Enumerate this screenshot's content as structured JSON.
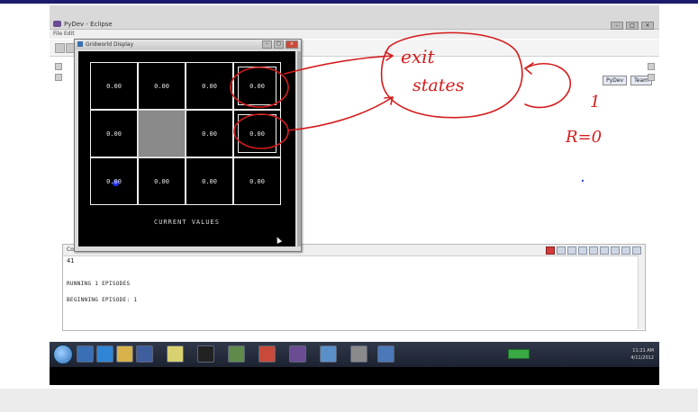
{
  "eclipse": {
    "title": "PyDev - Eclipse",
    "menubar": "File Edit",
    "perspective_pydev": "PyDev",
    "perspective_team": "Team"
  },
  "gridworld": {
    "window_title": "Gridworld Display",
    "caption": "CURRENT VALUES",
    "rows": [
      [
        "0.00",
        "0.00",
        "0.00",
        "0.00"
      ],
      [
        "0.00",
        "",
        "0.00",
        "0.00"
      ],
      [
        "0.00",
        "0.00",
        "0.00",
        "0.00"
      ]
    ],
    "wall_cell": [
      1,
      1
    ],
    "exit_cells": [
      [
        0,
        3
      ],
      [
        1,
        3
      ]
    ],
    "agent_cell": [
      2,
      0
    ]
  },
  "console": {
    "tab": "Console",
    "status": "41",
    "lines": [
      "RUNNING 1 EPISODES",
      "BEGINNING EPISODE: 1"
    ]
  },
  "annotations": {
    "exit_label": "exit",
    "states_label": "states",
    "loop_count": "1",
    "reward_label": "R=0",
    "color": "#d41c1c"
  },
  "taskbar": {
    "time": "11:21 AM",
    "date": "4/11/2012"
  }
}
